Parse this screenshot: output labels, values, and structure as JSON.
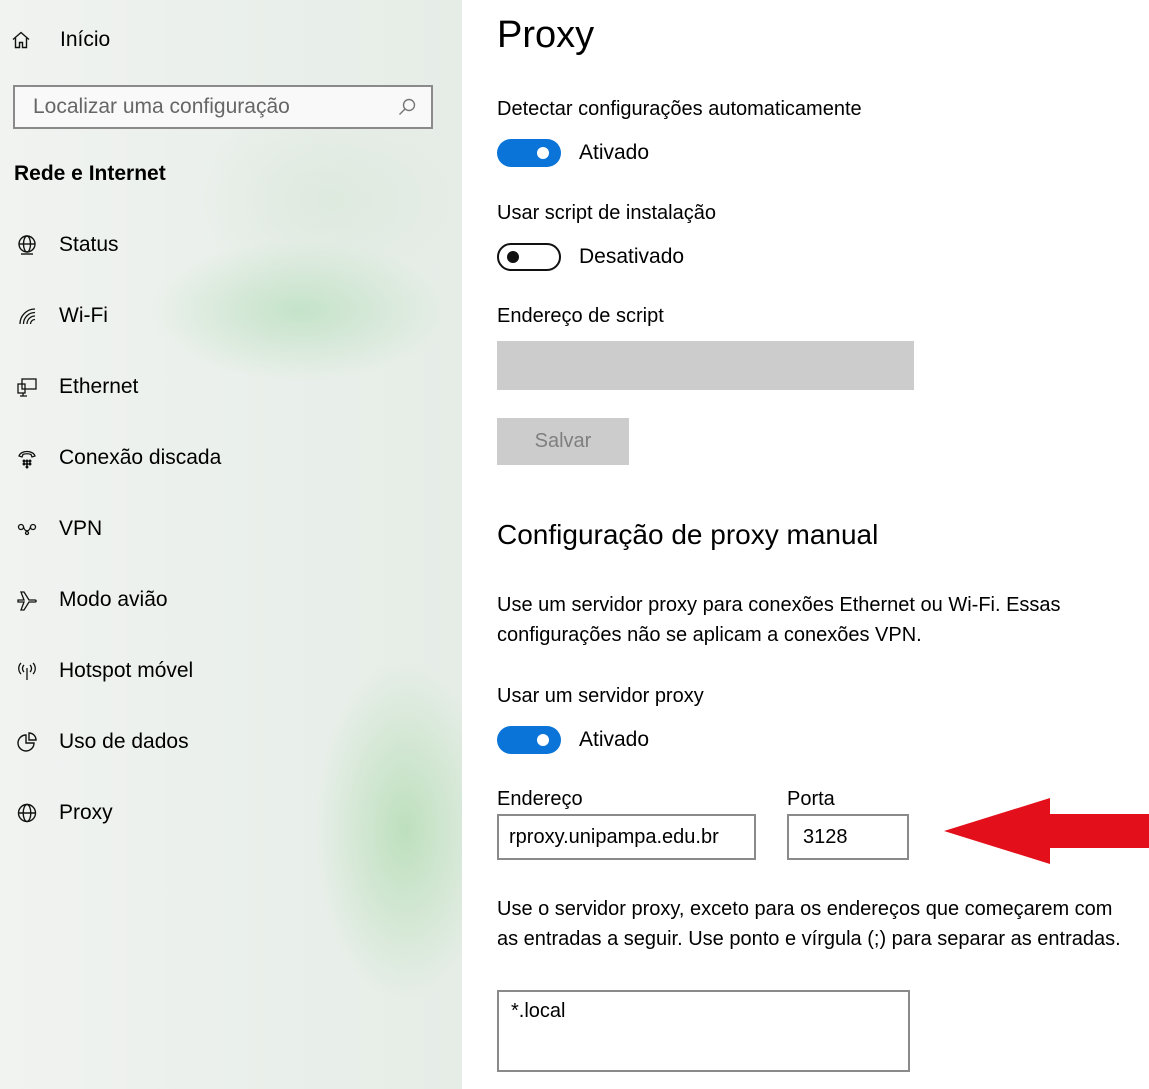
{
  "sidebar": {
    "home_label": "Início",
    "search": {
      "placeholder": "Localizar uma configuração",
      "value": ""
    },
    "section_title": "Rede e Internet",
    "items": [
      {
        "label": "Status",
        "icon": "globe-status-icon"
      },
      {
        "label": "Wi-Fi",
        "icon": "wifi-icon"
      },
      {
        "label": "Ethernet",
        "icon": "ethernet-icon"
      },
      {
        "label": "Conexão discada",
        "icon": "dial-up-icon"
      },
      {
        "label": "VPN",
        "icon": "vpn-icon"
      },
      {
        "label": "Modo avião",
        "icon": "airplane-icon"
      },
      {
        "label": "Hotspot móvel",
        "icon": "hotspot-icon"
      },
      {
        "label": "Uso de dados",
        "icon": "data-usage-icon"
      },
      {
        "label": "Proxy",
        "icon": "globe-icon"
      }
    ]
  },
  "main": {
    "title": "Proxy",
    "auto_detect": {
      "label": "Detectar configurações automaticamente",
      "state": "Ativado",
      "on": true
    },
    "setup_script": {
      "label": "Usar script de instalação",
      "state": "Desativado",
      "on": false
    },
    "script_address": {
      "label": "Endereço de script",
      "value": ""
    },
    "save_label": "Salvar",
    "manual_title": "Configuração de proxy manual",
    "manual_desc": "Use um servidor proxy para conexões Ethernet ou Wi-Fi. Essas configurações não se aplicam a conexões VPN.",
    "use_proxy": {
      "label": "Usar um servidor proxy",
      "state": "Ativado",
      "on": true
    },
    "address": {
      "label": "Endereço",
      "value": "rproxy.unipampa.edu.br"
    },
    "port": {
      "label": "Porta",
      "value": "3128"
    },
    "exceptions_desc": "Use o servidor proxy, exceto para os endereços que começarem com as entradas a seguir. Use ponto e vírgula (;) para separar as entradas.",
    "exceptions_value": "*.local"
  },
  "colors": {
    "accent": "#0a74d8",
    "annotation_arrow": "#e3101b",
    "disabled": "#cccccc"
  }
}
